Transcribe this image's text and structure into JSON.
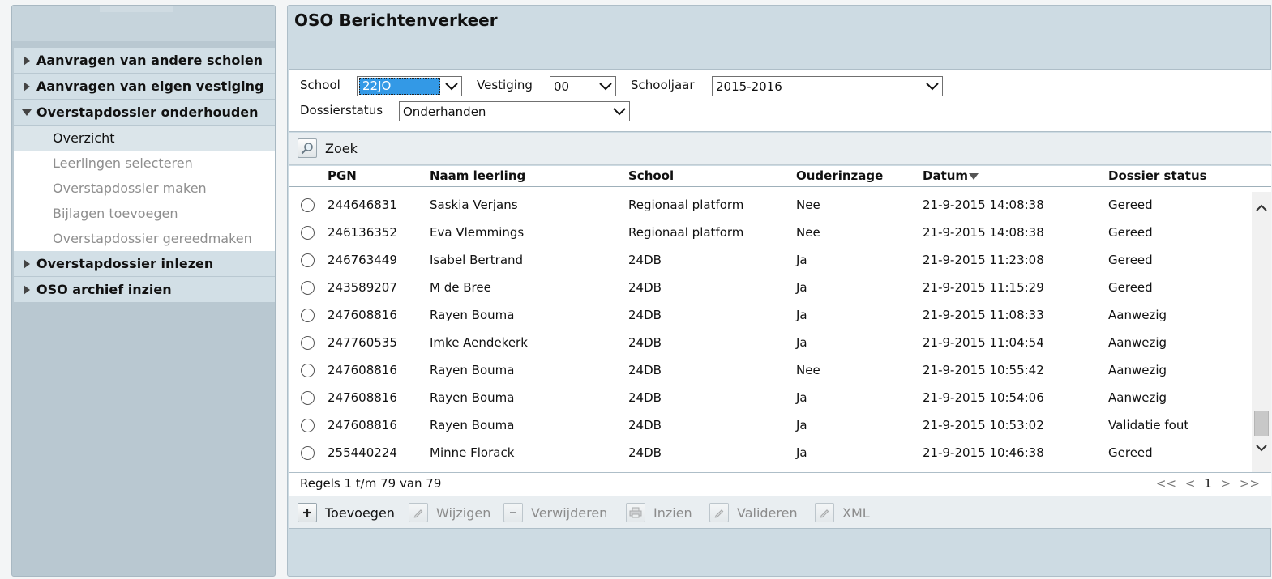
{
  "app": {
    "title": "OSO Berichtenverkeer"
  },
  "sidebar": {
    "menu": [
      {
        "label": "Aanvragen van andere scholen",
        "expanded": false
      },
      {
        "label": "Aanvragen van eigen vestiging",
        "expanded": false
      },
      {
        "label": "Overstapdossier onderhouden",
        "expanded": true,
        "children": [
          {
            "label": "Overzicht",
            "active": true
          },
          {
            "label": "Leerlingen selecteren",
            "active": false
          },
          {
            "label": "Overstapdossier maken",
            "active": false
          },
          {
            "label": "Bijlagen toevoegen",
            "active": false
          },
          {
            "label": "Overstapdossier gereedmaken",
            "active": false
          }
        ]
      },
      {
        "label": "Overstapdossier inlezen",
        "expanded": false
      },
      {
        "label": "OSO archief inzien",
        "expanded": false
      }
    ]
  },
  "filters": {
    "school_label": "School",
    "school_value": "22JO",
    "vestiging_label": "Vestiging",
    "vestiging_value": "00",
    "schooljaar_label": "Schooljaar",
    "schooljaar_value": "2015-2016",
    "dossierstatus_label": "Dossierstatus",
    "dossierstatus_value": "Onderhanden"
  },
  "search": {
    "label": "Zoek",
    "icon": "magnifier-icon"
  },
  "table": {
    "headers": {
      "pgn": "PGN",
      "naam": "Naam leerling",
      "school": "School",
      "ouderinzage": "Ouderinzage",
      "datum": "Datum",
      "status": "Dossier status"
    },
    "sort_column": "datum",
    "rows": [
      {
        "pgn": "244646831",
        "naam": "Saskia Verjans",
        "school": "Regionaal platform",
        "ouderinzage": "Nee",
        "datum": "21-9-2015 14:08:38",
        "status": "Gereed"
      },
      {
        "pgn": "246136352",
        "naam": "Eva Vlemmings",
        "school": "Regionaal platform",
        "ouderinzage": "Nee",
        "datum": "21-9-2015 14:08:38",
        "status": "Gereed"
      },
      {
        "pgn": "246763449",
        "naam": "Isabel Bertrand",
        "school": "24DB",
        "ouderinzage": "Ja",
        "datum": "21-9-2015 11:23:08",
        "status": "Gereed"
      },
      {
        "pgn": "243589207",
        "naam": "M de Bree",
        "school": "24DB",
        "ouderinzage": "Ja",
        "datum": "21-9-2015 11:15:29",
        "status": "Gereed"
      },
      {
        "pgn": "247608816",
        "naam": "Rayen Bouma",
        "school": "24DB",
        "ouderinzage": "Ja",
        "datum": "21-9-2015 11:08:33",
        "status": "Aanwezig"
      },
      {
        "pgn": "247760535",
        "naam": "Imke Aendekerk",
        "school": "24DB",
        "ouderinzage": "Ja",
        "datum": "21-9-2015 11:04:54",
        "status": "Aanwezig"
      },
      {
        "pgn": "247608816",
        "naam": "Rayen Bouma",
        "school": "24DB",
        "ouderinzage": "Nee",
        "datum": "21-9-2015 10:55:42",
        "status": "Aanwezig"
      },
      {
        "pgn": "247608816",
        "naam": "Rayen Bouma",
        "school": "24DB",
        "ouderinzage": "Ja",
        "datum": "21-9-2015 10:54:06",
        "status": "Aanwezig"
      },
      {
        "pgn": "247608816",
        "naam": "Rayen Bouma",
        "school": "24DB",
        "ouderinzage": "Ja",
        "datum": "21-9-2015 10:53:02",
        "status": "Validatie fout"
      },
      {
        "pgn": "255440224",
        "naam": "Minne Florack",
        "school": "24DB",
        "ouderinzage": "Ja",
        "datum": "21-9-2015 10:46:38",
        "status": "Gereed"
      }
    ]
  },
  "footer": {
    "rules_text": "Regels 1 t/m 79 van 79",
    "pager": {
      "first": "<<",
      "prev": "<",
      "page": "1",
      "next": ">",
      "last": ">>"
    }
  },
  "actions": [
    {
      "label": "Toevoegen",
      "icon": "plus-icon",
      "enabled": true
    },
    {
      "label": "Wijzigen",
      "icon": "pencil-icon",
      "enabled": false
    },
    {
      "label": "Verwijderen",
      "icon": "minus-icon",
      "enabled": false
    },
    {
      "label": "Inzien",
      "icon": "printer-icon",
      "enabled": false
    },
    {
      "label": "Valideren",
      "icon": "pencil-icon",
      "enabled": false
    },
    {
      "label": "XML",
      "icon": "pencil-icon",
      "enabled": false
    }
  ],
  "colors": {
    "panel": "#cddbe3",
    "sidebar": "#b9c8d1",
    "menu_item": "#d2dfe6",
    "selection": "#3399e6"
  }
}
